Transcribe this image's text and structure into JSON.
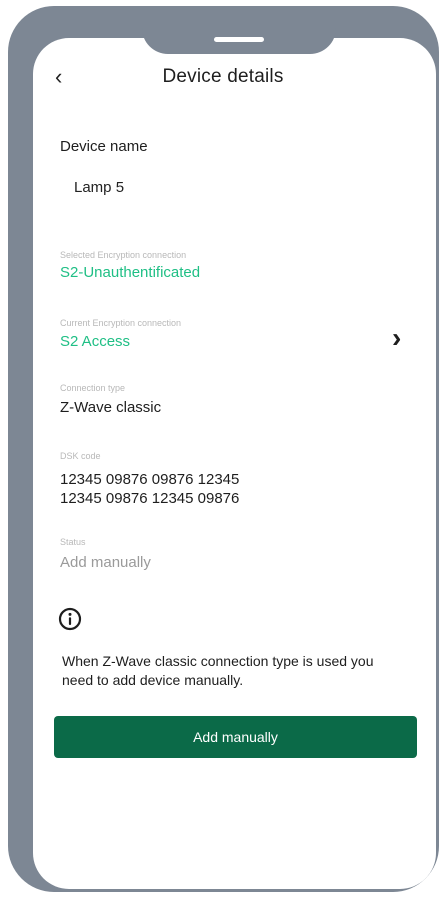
{
  "header": {
    "title": "Device details",
    "back_icon": "chevron-left-icon"
  },
  "device_name": {
    "section_title": "Device name",
    "value": "Lamp 5"
  },
  "fields": {
    "encryption": {
      "label": "Selected Encryption connection",
      "value": "S2-Unauthentificated"
    },
    "access": {
      "label": "Current Encryption connection",
      "value": "S2 Access"
    },
    "connection_type": {
      "label": "Connection type",
      "value": "Z-Wave classic"
    },
    "dsk": {
      "label": "DSK code",
      "line1": "12345 09876 09876 12345",
      "line2": "12345 09876 12345 09876"
    },
    "status": {
      "label": "Status",
      "value": "Add manually"
    }
  },
  "note": {
    "icon": "info-icon",
    "text": "When Z-Wave classic connection type is used you need to add device manually."
  },
  "actions": {
    "add_manually": "Add manually"
  },
  "colors": {
    "frame": "#7d8794",
    "accent_green": "#1fbf85",
    "button": "#0b6a48"
  }
}
